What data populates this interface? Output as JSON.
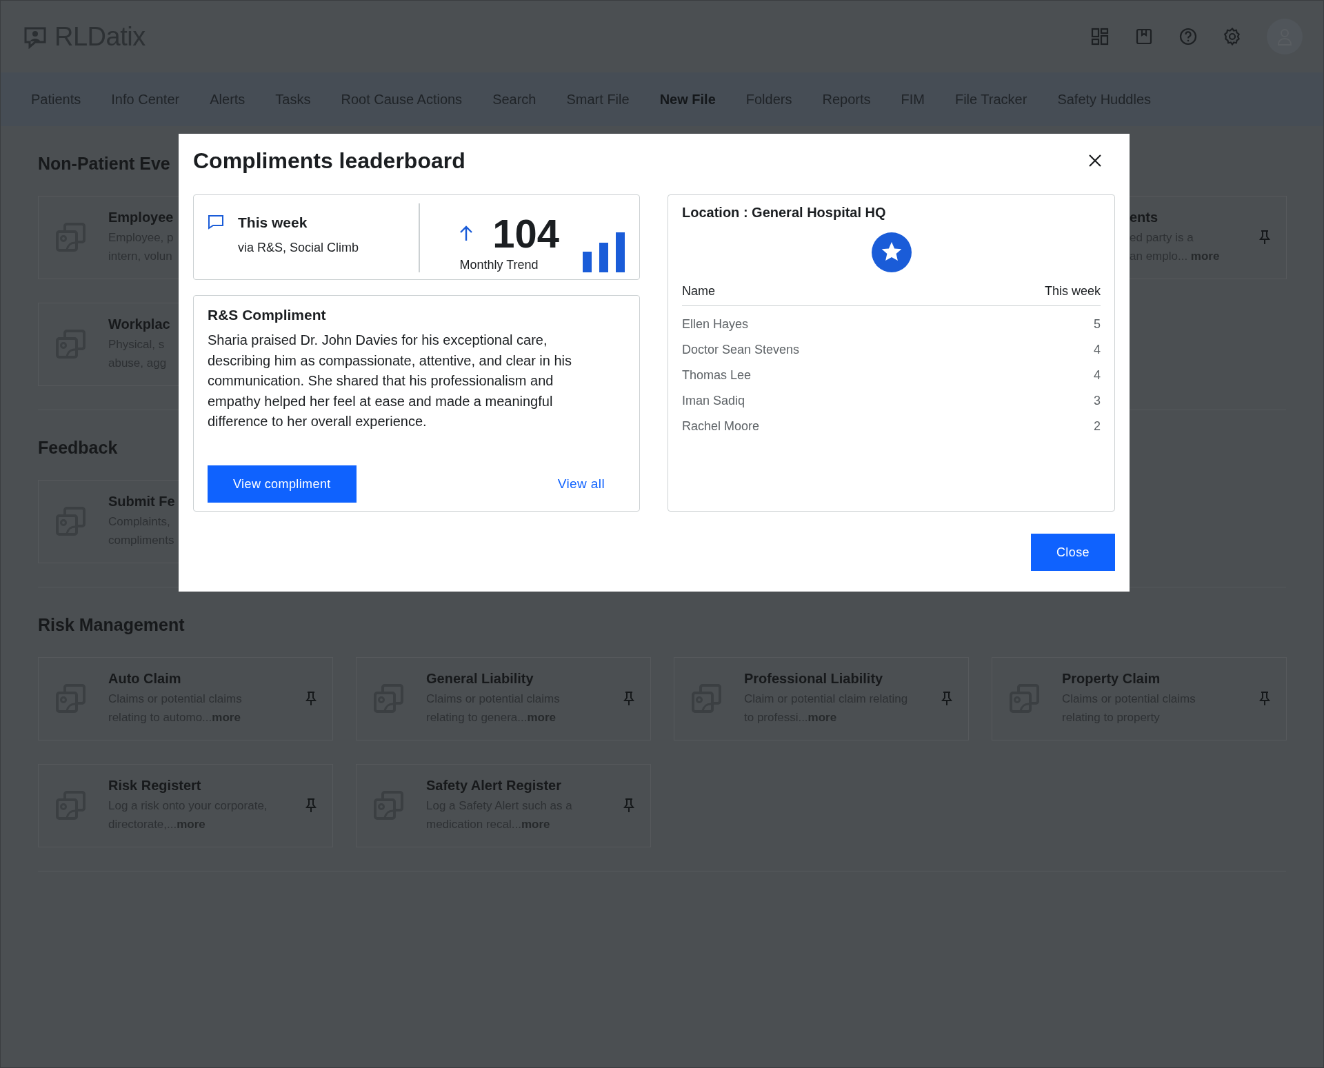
{
  "header": {
    "logo": "RLDatix"
  },
  "nav": [
    {
      "label": "Patients",
      "selected": false
    },
    {
      "label": "Info Center",
      "selected": false
    },
    {
      "label": "Alerts",
      "selected": false
    },
    {
      "label": "Tasks",
      "selected": false
    },
    {
      "label": "Root Cause Actions",
      "selected": false
    },
    {
      "label": "Search",
      "selected": false
    },
    {
      "label": "Smart File",
      "selected": false
    },
    {
      "label": "New File",
      "selected": true
    },
    {
      "label": "Folders",
      "selected": false
    },
    {
      "label": "Reports",
      "selected": false
    },
    {
      "label": "FIM",
      "selected": false
    },
    {
      "label": "File Tracker",
      "selected": false
    },
    {
      "label": "Safety Huddles",
      "selected": false
    }
  ],
  "sections": [
    {
      "title": "Non-Patient Eve",
      "cards": [
        {
          "kind": "left-cut",
          "title": "Employee",
          "desc_lines": [
            "Employee, p",
            "intern, volun"
          ]
        },
        {
          "kind": "right-cut",
          "title": "ents",
          "desc_lines": [
            "ed party is a",
            "an emplo... **more**"
          ]
        },
        {
          "kind": "left-cut",
          "title": "Workplac",
          "desc_lines": [
            "Physical, s",
            "abuse, agg"
          ]
        }
      ]
    },
    {
      "title": "Feedback",
      "cards": [
        {
          "kind": "left-cut",
          "title": "Submit Fe",
          "desc_lines": [
            "Complaints,",
            "compliments"
          ]
        }
      ]
    },
    {
      "title": "Risk Management",
      "cards": [
        {
          "kind": "full",
          "title": "Auto Claim",
          "desc_lines": [
            "Claims or potential claims",
            "relating to automo...**more**"
          ]
        },
        {
          "kind": "full",
          "title": "General Liability",
          "desc_lines": [
            "Claims or potential claims",
            "relating to genera...**more**"
          ]
        },
        {
          "kind": "full",
          "title": "Professional Liability",
          "desc_lines": [
            "Claim or potential claim relating",
            "to professi...**more**"
          ]
        },
        {
          "kind": "full",
          "title": "Property Claim",
          "desc_lines": [
            "Claims or potential claims",
            "relating to property"
          ]
        },
        {
          "kind": "full",
          "title": "Risk Registert",
          "desc_lines": [
            "Log a risk onto your corporate,",
            "directorate,...**more**"
          ]
        },
        {
          "kind": "full",
          "title": "Safety Alert Register",
          "desc_lines": [
            "Log a Safety Alert such as a",
            "medication recal...**more**"
          ]
        }
      ]
    }
  ],
  "modal": {
    "title": "Compliments leaderboard",
    "stat": {
      "label": "This week",
      "sources": "via R&S, Social Climb",
      "count": "104",
      "trend_label": "Monthly Trend"
    },
    "compliment": {
      "title": "R&S Compliment",
      "text": "Sharia praised Dr. John Davies for his exceptional care, describing him as compassionate, attentive, and clear in his communication. She shared that his professionalism and empathy helped her feel at ease and made a meaningful difference to her overall experience.",
      "primary_button": "View compliment",
      "link": "View all"
    },
    "leaderboard": {
      "title": "Location : General Hospital HQ",
      "columns": [
        "Name",
        "This week"
      ],
      "rows": [
        {
          "name": "Ellen Hayes",
          "count": "5"
        },
        {
          "name": "Doctor Sean Stevens",
          "count": "4"
        },
        {
          "name": "Thomas Lee",
          "count": "4"
        },
        {
          "name": "Iman Sadiq",
          "count": "3"
        },
        {
          "name": "Rachel Moore",
          "count": "2"
        }
      ]
    },
    "close_button": "Close"
  }
}
